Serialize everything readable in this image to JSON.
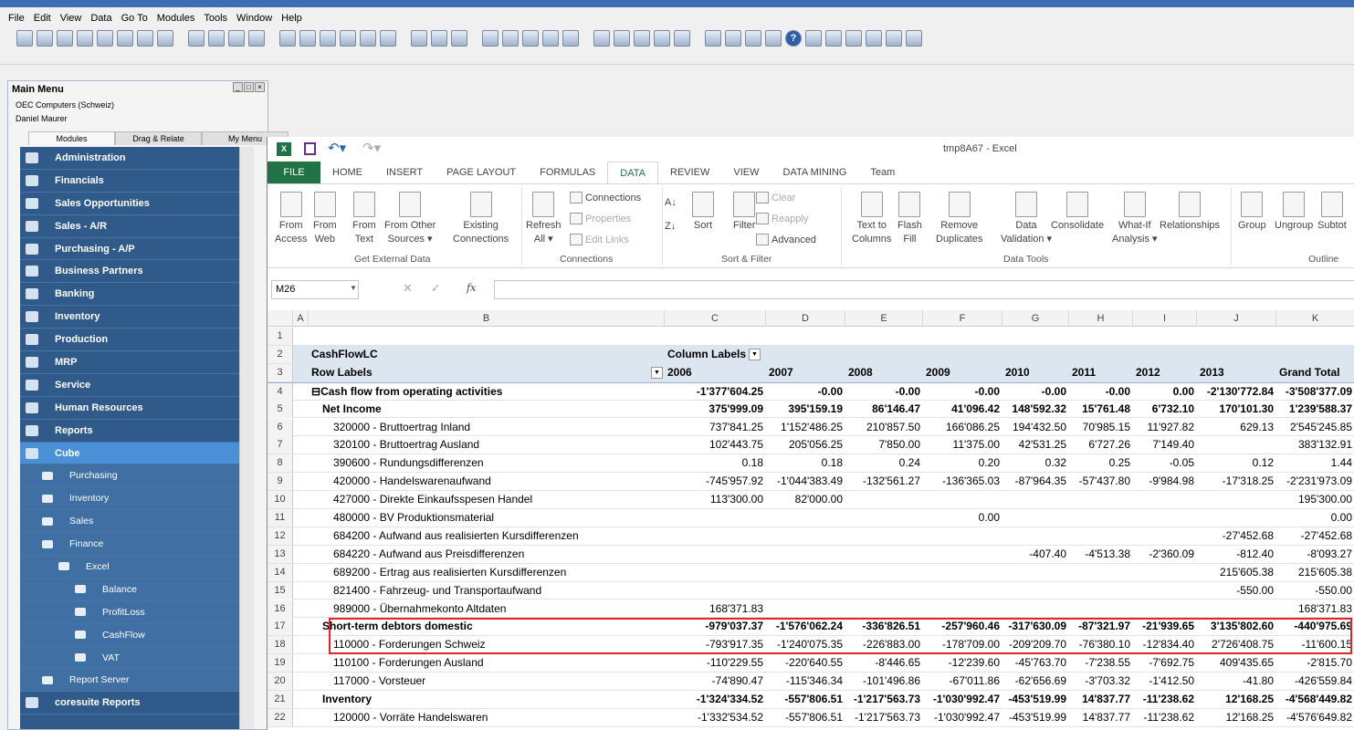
{
  "menubar": [
    "File",
    "Edit",
    "View",
    "Data",
    "Go To",
    "Modules",
    "Tools",
    "Window",
    "Help"
  ],
  "main_menu": {
    "title": "Main Menu",
    "company": "OEC Computers (Schweiz)",
    "user": "Daniel Maurer",
    "tabs": [
      "Modules",
      "Drag & Relate",
      "My Menu"
    ],
    "items": [
      {
        "label": "Administration",
        "level": 0
      },
      {
        "label": "Financials",
        "level": 0
      },
      {
        "label": "Sales Opportunities",
        "level": 0
      },
      {
        "label": "Sales - A/R",
        "level": 0
      },
      {
        "label": "Purchasing - A/P",
        "level": 0
      },
      {
        "label": "Business Partners",
        "level": 0
      },
      {
        "label": "Banking",
        "level": 0
      },
      {
        "label": "Inventory",
        "level": 0
      },
      {
        "label": "Production",
        "level": 0
      },
      {
        "label": "MRP",
        "level": 0
      },
      {
        "label": "Service",
        "level": 0
      },
      {
        "label": "Human Resources",
        "level": 0
      },
      {
        "label": "Reports",
        "level": 0
      },
      {
        "label": "Cube",
        "level": 0,
        "selected": true
      },
      {
        "label": "Purchasing",
        "level": 1
      },
      {
        "label": "Inventory",
        "level": 1
      },
      {
        "label": "Sales",
        "level": 1
      },
      {
        "label": "Finance",
        "level": 1
      },
      {
        "label": "Excel",
        "level": 2
      },
      {
        "label": "Balance",
        "level": 3
      },
      {
        "label": "ProfitLoss",
        "level": 3
      },
      {
        "label": "CashFlow",
        "level": 3
      },
      {
        "label": "VAT",
        "level": 3
      },
      {
        "label": "Report Server",
        "level": 1
      },
      {
        "label": "coresuite Reports",
        "level": 0
      }
    ]
  },
  "excel": {
    "title": "tmp8A67 - Excel",
    "tabs": [
      "FILE",
      "HOME",
      "INSERT",
      "PAGE LAYOUT",
      "FORMULAS",
      "DATA",
      "REVIEW",
      "VIEW",
      "DATA MINING",
      "Team"
    ],
    "active_tab": "DATA",
    "ribbon": {
      "big": [
        [
          "From",
          "Access"
        ],
        [
          "From",
          "Web"
        ],
        [
          "From",
          "Text"
        ],
        [
          "From Other",
          "Sources ▾"
        ],
        [
          "Existing",
          "Connections"
        ],
        [
          "Refresh",
          "All ▾"
        ],
        [
          "",
          "Sort"
        ],
        [
          "",
          "Filter"
        ],
        [
          "Text to",
          "Columns"
        ],
        [
          "Flash",
          "Fill"
        ],
        [
          "Remove",
          "Duplicates"
        ],
        [
          "Data",
          "Validation ▾"
        ],
        [
          "",
          "Consolidate"
        ],
        [
          "What-If",
          "Analysis ▾"
        ],
        [
          "",
          "Relationships"
        ],
        [
          "",
          "Group"
        ],
        [
          "",
          "Ungroup"
        ],
        [
          "",
          "Subtot"
        ]
      ],
      "small": [
        "Connections",
        "Properties",
        "Edit Links",
        "Clear",
        "Reapply",
        "Advanced"
      ],
      "groups": [
        "Get External Data",
        "Connections",
        "Sort & Filter",
        "Data Tools",
        "Outline"
      ]
    },
    "name_box": "M26",
    "fx": "fx",
    "columns": [
      "A",
      "B",
      "C",
      "D",
      "E",
      "F",
      "G",
      "H",
      "I",
      "J",
      "K"
    ],
    "pivot": {
      "row2_label": "CashFlowLC",
      "column_labels": "Column Labels",
      "row_labels": "Row Labels",
      "years": [
        "2006",
        "2007",
        "2008",
        "2009",
        "2010",
        "2011",
        "2012",
        "2013",
        "Grand Total"
      ]
    },
    "rows": [
      {
        "n": 1,
        "cells": []
      },
      {
        "n": 2
      },
      {
        "n": 3
      },
      {
        "n": 4,
        "label": "Cash flow from operating activities",
        "lvl": 0,
        "bold": true,
        "v": [
          "-1'377'604.25",
          "-0.00",
          "-0.00",
          "-0.00",
          "-0.00",
          "-0.00",
          "0.00",
          "-2'130'772.84",
          "-3'508'377.09"
        ]
      },
      {
        "n": 5,
        "label": "Net Income",
        "lvl": 1,
        "bold": true,
        "v": [
          "375'999.09",
          "395'159.19",
          "86'146.47",
          "41'096.42",
          "148'592.32",
          "15'761.48",
          "6'732.10",
          "170'101.30",
          "1'239'588.37"
        ]
      },
      {
        "n": 6,
        "label": "320000 - Bruttoertrag Inland",
        "lvl": 2,
        "v": [
          "737'841.25",
          "1'152'486.25",
          "210'857.50",
          "166'086.25",
          "194'432.50",
          "70'985.15",
          "11'927.82",
          "629.13",
          "2'545'245.85"
        ]
      },
      {
        "n": 7,
        "label": "320100 - Bruttoertrag Ausland",
        "lvl": 2,
        "v": [
          "102'443.75",
          "205'056.25",
          "7'850.00",
          "11'375.00",
          "42'531.25",
          "6'727.26",
          "7'149.40",
          "",
          "383'132.91"
        ]
      },
      {
        "n": 8,
        "label": "390600 - Rundungsdifferenzen",
        "lvl": 2,
        "v": [
          "0.18",
          "0.18",
          "0.24",
          "0.20",
          "0.32",
          "0.25",
          "-0.05",
          "0.12",
          "1.44"
        ]
      },
      {
        "n": 9,
        "label": "420000 - Handelswarenaufwand",
        "lvl": 2,
        "v": [
          "-745'957.92",
          "-1'044'383.49",
          "-132'561.27",
          "-136'365.03",
          "-87'964.35",
          "-57'437.80",
          "-9'984.98",
          "-17'318.25",
          "-2'231'973.09"
        ]
      },
      {
        "n": 10,
        "label": "427000 - Direkte Einkaufsspesen Handel",
        "lvl": 2,
        "v": [
          "113'300.00",
          "82'000.00",
          "",
          "",
          "",
          "",
          "",
          "",
          "195'300.00"
        ]
      },
      {
        "n": 11,
        "label": "480000 - BV Produktionsmaterial",
        "lvl": 2,
        "v": [
          "",
          "",
          "",
          "0.00",
          "",
          "",
          "",
          "",
          "0.00"
        ]
      },
      {
        "n": 12,
        "label": "684200 - Aufwand aus realisierten Kursdifferenzen",
        "lvl": 2,
        "v": [
          "",
          "",
          "",
          "",
          "",
          "",
          "",
          "-27'452.68",
          "-27'452.68"
        ]
      },
      {
        "n": 13,
        "label": "684220 - Aufwand aus Preisdifferenzen",
        "lvl": 2,
        "v": [
          "",
          "",
          "",
          "",
          "-407.40",
          "-4'513.38",
          "-2'360.09",
          "-812.40",
          "-8'093.27"
        ]
      },
      {
        "n": 14,
        "label": "689200 - Ertrag aus realisierten Kursdifferenzen",
        "lvl": 2,
        "v": [
          "",
          "",
          "",
          "",
          "",
          "",
          "",
          "215'605.38",
          "215'605.38"
        ]
      },
      {
        "n": 15,
        "label": "821400 - Fahrzeug- und Transportaufwand",
        "lvl": 2,
        "v": [
          "",
          "",
          "",
          "",
          "",
          "",
          "",
          "-550.00",
          "-550.00"
        ]
      },
      {
        "n": 16,
        "label": "989000 - Übernahmekonto Altdaten",
        "lvl": 2,
        "v": [
          "168'371.83",
          "",
          "",
          "",
          "",
          "",
          "",
          "",
          "168'371.83"
        ]
      },
      {
        "n": 17,
        "label": "Short-term debtors domestic",
        "lvl": 1,
        "bold": true,
        "v": [
          "-979'037.37",
          "-1'576'062.24",
          "-336'826.51",
          "-257'960.46",
          "-317'630.09",
          "-87'321.97",
          "-21'939.65",
          "3'135'802.60",
          "-440'975.69"
        ]
      },
      {
        "n": 18,
        "label": "110000 - Forderungen Schweiz",
        "lvl": 2,
        "v": [
          "-793'917.35",
          "-1'240'075.35",
          "-226'883.00",
          "-178'709.00",
          "-209'209.70",
          "-76'380.10",
          "-12'834.40",
          "2'726'408.75",
          "-11'600.15"
        ]
      },
      {
        "n": 19,
        "label": "110100 - Forderungen Ausland",
        "lvl": 2,
        "v": [
          "-110'229.55",
          "-220'640.55",
          "-8'446.65",
          "-12'239.60",
          "-45'763.70",
          "-7'238.55",
          "-7'692.75",
          "409'435.65",
          "-2'815.70"
        ]
      },
      {
        "n": 20,
        "label": "117000 - Vorsteuer",
        "lvl": 2,
        "v": [
          "-74'890.47",
          "-115'346.34",
          "-101'496.86",
          "-67'011.86",
          "-62'656.69",
          "-3'703.32",
          "-1'412.50",
          "-41.80",
          "-426'559.84"
        ]
      },
      {
        "n": 21,
        "label": "Inventory",
        "lvl": 1,
        "bold": true,
        "v": [
          "-1'324'334.52",
          "-557'806.51",
          "-1'217'563.73",
          "-1'030'992.47",
          "-453'519.99",
          "14'837.77",
          "-11'238.62",
          "12'168.25",
          "-4'568'449.82"
        ]
      },
      {
        "n": 22,
        "label": "120000 - Vorräte Handelswaren",
        "lvl": 2,
        "v": [
          "-1'332'534.52",
          "-557'806.51",
          "-1'217'563.73",
          "-1'030'992.47",
          "-453'519.99",
          "14'837.77",
          "-11'238.62",
          "12'168.25",
          "-4'576'649.82"
        ]
      }
    ],
    "highlight_rows": [
      17,
      18
    ],
    "colors": {
      "excel_green": "#217346",
      "sidebar_blue": "#2f5a8a",
      "sidebar_selected": "#4a90d9",
      "pivot_header": "#dce6f1",
      "highlight": "#e0242b"
    }
  }
}
